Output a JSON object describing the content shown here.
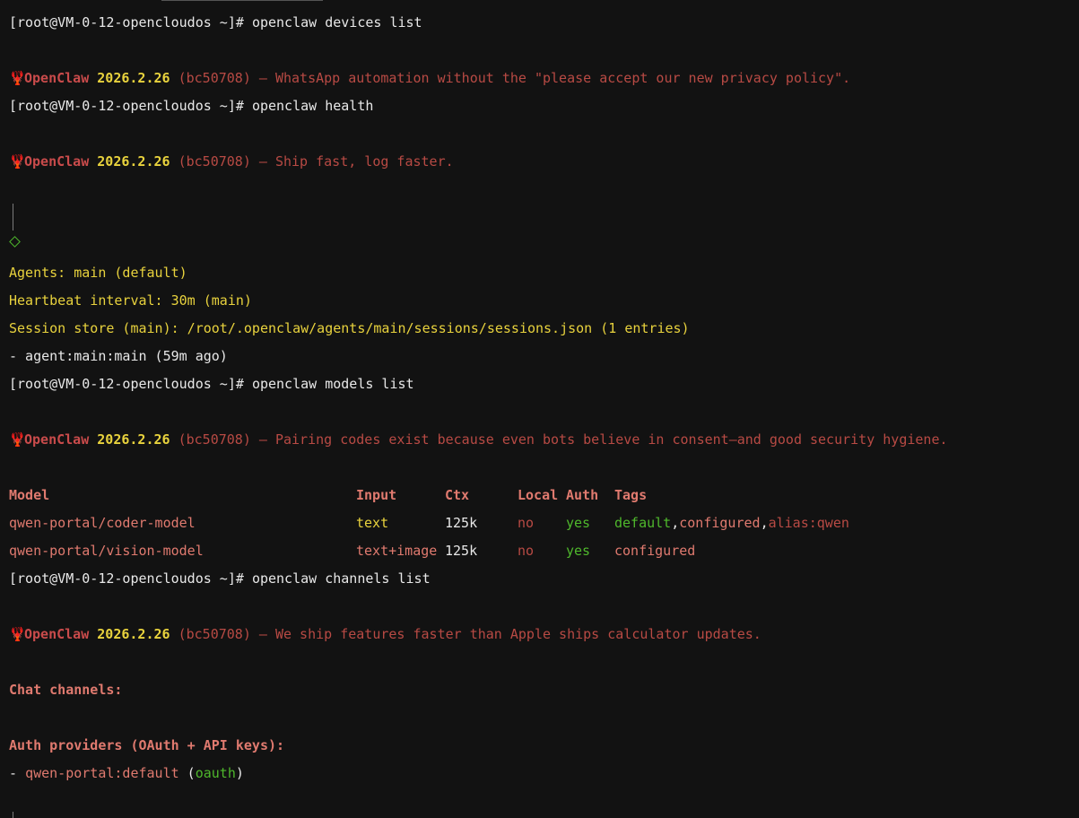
{
  "colors": {
    "background": "#121212",
    "prompt_text": "#e8e8e8",
    "brand_red": "#c94b4b",
    "version_yellow": "#e8d23d",
    "tagline_red": "#b84a44",
    "green": "#4fb82c",
    "header_salmon": "#e07a6f"
  },
  "prompt": "[root@VM-0-12-opencloudos ~]# ",
  "commands": {
    "devices": "openclaw devices list",
    "health": "openclaw health",
    "models": "openclaw models list",
    "channels": "openclaw channels list"
  },
  "banner": {
    "icon": "lobster-icon",
    "name": "OpenClaw",
    "version": "2026.2.26",
    "build": "(bc50708)",
    "dash": "—",
    "taglines": {
      "devices": "WhatsApp automation without the \"please accept our new privacy policy\".",
      "health": "Ship fast, log faster.",
      "models": "Pairing codes exist because even bots believe in consent—and good security hygiene.",
      "channels": "We ship features faster than Apple ships calculator updates."
    }
  },
  "health": {
    "agents": "Agents: main (default)",
    "heartbeat": "Heartbeat interval: 30m (main)",
    "session_store": "Session store (main): /root/.openclaw/agents/main/sessions/sessions.json (1 entries)",
    "agent_item": "- agent:main:main (59m ago)"
  },
  "models_table": {
    "headers": [
      "Model",
      "Input",
      "Ctx",
      "Local",
      "Auth",
      "Tags"
    ],
    "rows": [
      {
        "model": "qwen-portal/coder-model",
        "input": "text",
        "ctx": "125k",
        "local": "no",
        "auth": "yes",
        "tags": [
          "default",
          ",",
          "configured",
          ",",
          "alias:qwen"
        ]
      },
      {
        "model": "qwen-portal/vision-model",
        "input": "text+image",
        "ctx": "125k",
        "local": "no",
        "auth": "yes",
        "tags": [
          "configured"
        ]
      }
    ]
  },
  "channels": {
    "chat_header": "Chat channels:",
    "auth_header": "Auth providers (OAuth + API keys):",
    "provider_prefix": "- ",
    "provider_name": "qwen-portal:default",
    "provider_open": " (",
    "provider_method": "oauth",
    "provider_close": ")"
  }
}
